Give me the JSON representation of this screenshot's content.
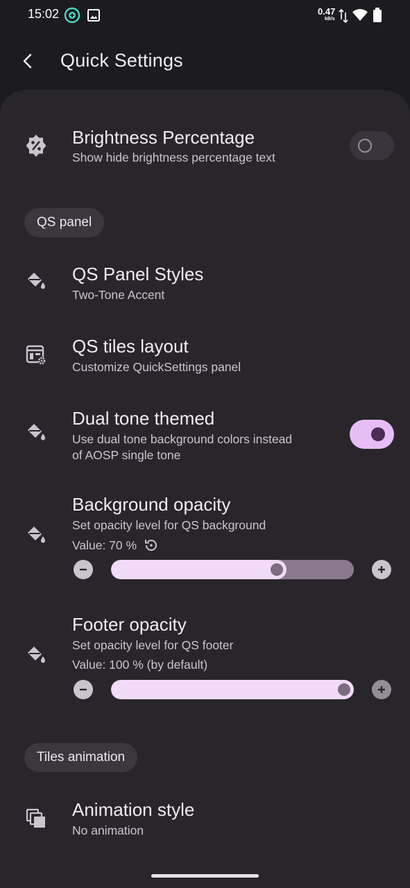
{
  "status_bar": {
    "time": "15:02",
    "net_speed": "0.47",
    "net_unit": "kB/s",
    "icons": [
      "vpn-icon",
      "image-icon",
      "data-transfer-icon",
      "wifi-icon",
      "battery-icon"
    ]
  },
  "app_bar": {
    "title": "Quick Settings"
  },
  "brightness": {
    "title": "Brightness Percentage",
    "subtitle": "Show hide brightness percentage text",
    "enabled": false
  },
  "sections": {
    "qs_panel": "QS panel",
    "tiles_animation": "Tiles animation"
  },
  "qs_panel_styles": {
    "title": "QS Panel Styles",
    "subtitle": "Two-Tone Accent"
  },
  "qs_tiles_layout": {
    "title": "QS tiles layout",
    "subtitle": "Customize QuickSettings panel"
  },
  "dual_tone": {
    "title": "Dual tone themed",
    "subtitle_line1": "Use dual tone background colors instead",
    "subtitle_line2": "of AOSP single tone",
    "enabled": true
  },
  "background_opacity": {
    "title": "Background opacity",
    "subtitle": "Set opacity level for QS background",
    "value_text": "Value: 70 %",
    "value": 70
  },
  "footer_opacity": {
    "title": "Footer opacity",
    "subtitle": "Set opacity level for QS footer",
    "value_text": "Value: 100 % (by default)",
    "value": 100
  },
  "animation_style": {
    "title": "Animation style",
    "subtitle": "No animation"
  },
  "colors": {
    "background": "#1c1b1f",
    "card": "#28262b",
    "accent": "#e7bdf5",
    "slider_active": "#f1dbf8",
    "slider_inactive": "#8a7a8f"
  }
}
